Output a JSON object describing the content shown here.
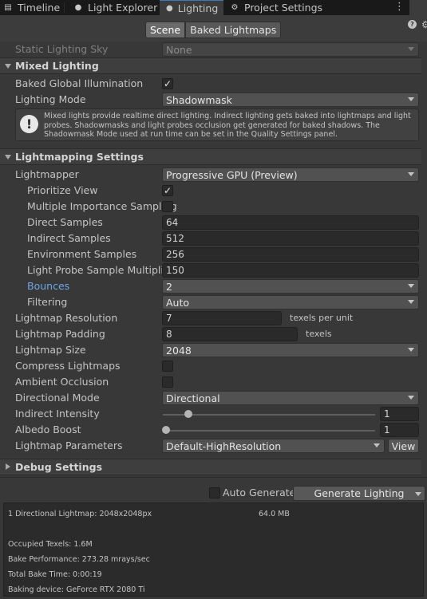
{
  "tabs": [
    {
      "label": "Timeline",
      "icon": "timeline-icon"
    },
    {
      "label": "Light Explorer",
      "icon": "lightbulb-icon"
    },
    {
      "label": "Lighting",
      "icon": "lightbulb-icon"
    },
    {
      "label": "Project Settings",
      "icon": "gear-icon"
    }
  ],
  "toolbar": {
    "scene": "Scene",
    "baked": "Baked Lightmaps"
  },
  "static_sky": {
    "label": "Static Lighting Sky",
    "value": "None"
  },
  "mixed": {
    "header": "Mixed Lighting",
    "baked_gi": "Baked Global Illumination",
    "mode_label": "Lighting Mode",
    "mode_value": "Shadowmask",
    "info": "Mixed lights provide realtime direct lighting. Indirect lighting gets baked into lightmaps and light probes. Shadowmasks and light probes occlusion get generated for baked shadows. The Shadowmask Mode used at run time can be set in the Quality Settings panel."
  },
  "lm": {
    "header": "Lightmapping Settings",
    "lightmapper": {
      "label": "Lightmapper",
      "value": "Progressive GPU (Preview)"
    },
    "prioritize": "Prioritize View",
    "mis": "Multiple Importance Sampling",
    "direct": {
      "label": "Direct Samples",
      "value": "64"
    },
    "indirect": {
      "label": "Indirect Samples",
      "value": "512"
    },
    "env": {
      "label": "Environment Samples",
      "value": "256"
    },
    "probe": {
      "label": "Light Probe Sample Multiplier",
      "value": "150"
    },
    "bounces": {
      "label": "Bounces",
      "value": "2"
    },
    "filtering": {
      "label": "Filtering",
      "value": "Auto"
    },
    "resolution": {
      "label": "Lightmap Resolution",
      "value": "7",
      "suffix": "texels per unit"
    },
    "padding": {
      "label": "Lightmap Padding",
      "value": "8",
      "suffix": "texels"
    },
    "size": {
      "label": "Lightmap Size",
      "value": "2048"
    },
    "compress": "Compress Lightmaps",
    "ao": "Ambient Occlusion",
    "dirmode": {
      "label": "Directional Mode",
      "value": "Directional"
    },
    "indirect_intensity": {
      "label": "Indirect Intensity",
      "value": "1",
      "level": 0.11
    },
    "albedo": {
      "label": "Albedo Boost",
      "value": "1",
      "level": 0.0
    },
    "params": {
      "label": "Lightmap Parameters",
      "value": "Default-HighResolution",
      "button": "View"
    }
  },
  "debug": {
    "header": "Debug Settings"
  },
  "bottom": {
    "auto": "Auto Generate",
    "generate": "Generate Lighting"
  },
  "stats": {
    "lightmaps": "1 Directional Lightmap: 2048x2048px",
    "size": "64.0 MB",
    "texels": "Occupied Texels: 1.6M",
    "perf": "Bake Performance: 273.28 mrays/sec",
    "time": "Total Bake Time: 0:00:19",
    "device": "Baking device: GeForce RTX 2080 Ti"
  }
}
